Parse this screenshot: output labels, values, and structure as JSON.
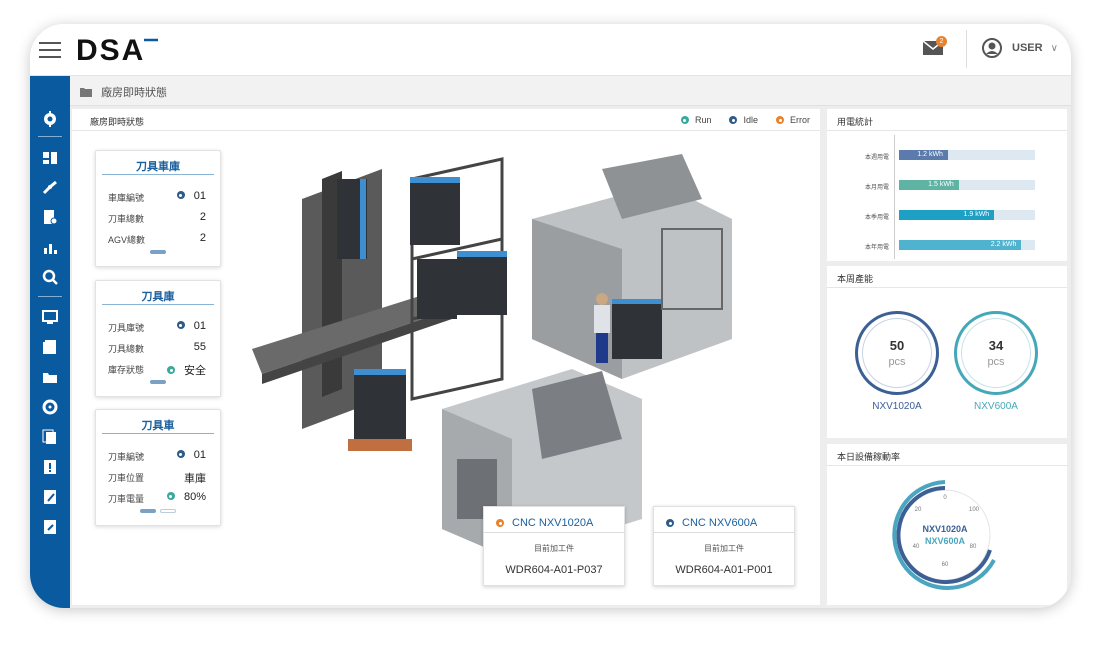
{
  "header": {
    "logo": "DSA",
    "user": "USER",
    "mail_count": "2"
  },
  "breadcrumb": "廠房即時狀態",
  "main": {
    "title": "廠房即時狀態",
    "legend": [
      {
        "label": "Run",
        "color": "#3aa89a"
      },
      {
        "label": "Idle",
        "color": "#2e5c8a"
      },
      {
        "label": "Error",
        "color": "#e8822c"
      }
    ]
  },
  "cards": {
    "tool_garage": {
      "title": "刀具車庫",
      "rows": [
        {
          "label": "車庫編號",
          "value": "01",
          "dot": "#2e5c8a"
        },
        {
          "label": "刀車總數",
          "value": "2"
        },
        {
          "label": "AGV總數",
          "value": "2"
        }
      ]
    },
    "tool_store": {
      "title": "刀具庫",
      "rows": [
        {
          "label": "刀具庫號",
          "value": "01",
          "dot": "#2e5c8a"
        },
        {
          "label": "刀具總數",
          "value": "55"
        },
        {
          "label": "庫存狀態",
          "value": "安全",
          "dot": "#3aa89a"
        }
      ]
    },
    "tool_cart": {
      "title": "刀具車",
      "rows": [
        {
          "label": "刀車編號",
          "value": "01",
          "dot": "#2e5c8a"
        },
        {
          "label": "刀車位置",
          "value": "車庫"
        },
        {
          "label": "刀車電量",
          "value": "80%",
          "dot": "#3aa89a"
        }
      ]
    }
  },
  "machines": [
    {
      "name": "CNC NXV1020A",
      "status_color": "#e8822c",
      "label": "目前加工件",
      "value": "WDR604-A01-P037"
    },
    {
      "name": "CNC NXV600A",
      "status_color": "#2e5c8a",
      "label": "目前加工件",
      "value": "WDR604-A01-P001"
    }
  ],
  "energy": {
    "title": "用電統計",
    "rows": [
      {
        "label": "本週用電",
        "value": "1.2",
        "unit": "kWh",
        "fraction": 0.36,
        "color": "#5a7bab"
      },
      {
        "label": "本月用電",
        "value": "1.5",
        "unit": "kWh",
        "fraction": 0.44,
        "color": "#5fb3a3"
      },
      {
        "label": "本季用電",
        "value": "1.9",
        "unit": "kWh",
        "fraction": 0.7,
        "color": "#1e9fc4"
      },
      {
        "label": "本年用電",
        "value": "2.2",
        "unit": "kWh",
        "fraction": 0.9,
        "color": "#4fb3d0"
      }
    ]
  },
  "capacity": {
    "title": "本周產能",
    "items": [
      {
        "value": "50",
        "unit": "pcs",
        "name": "NXV1020A",
        "color": "#3c5f94"
      },
      {
        "value": "34",
        "unit": "pcs",
        "name": "NXV600A",
        "color": "#45a8b8"
      }
    ]
  },
  "utilization": {
    "title": "本日設備稼動率",
    "ticks": [
      "0",
      "20",
      "100",
      "40",
      "80",
      "60"
    ],
    "names": [
      "NXV1020A",
      "NXV600A"
    ]
  },
  "colors": {
    "brand_blue": "#0a5aa0",
    "run": "#3aa89a",
    "idle": "#2e5c8a",
    "error": "#e8822c"
  }
}
